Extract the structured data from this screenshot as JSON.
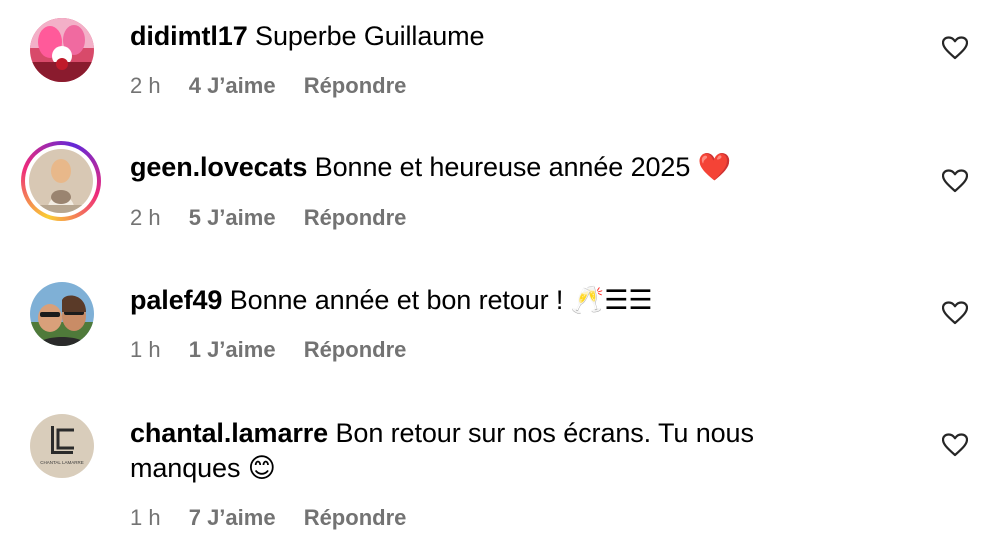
{
  "comments": [
    {
      "username": "didimtl17",
      "text": "Superbe Guillaume",
      "time": "2 h",
      "likes": "4 J’aime",
      "reply": "Répondre",
      "avatar_icon": "avatar-photo-pink"
    },
    {
      "username": "geen.lovecats",
      "text": "Bonne et heureuse année 2025 ",
      "emoji": "❤️",
      "time": "2 h",
      "likes": "5 J’aime",
      "reply": "Répondre",
      "avatar_icon": "avatar-photo-story-ring"
    },
    {
      "username": "palef49",
      "text": "Bonne année et bon retour ! ",
      "emoji": "🥂☰☰",
      "time": "1 h",
      "likes": "1 J’aime",
      "reply": "Répondre",
      "avatar_icon": "avatar-photo-couple"
    },
    {
      "username": "chantal.lamarre",
      "text": "Bon retour sur nos écrans. Tu nous manques ",
      "emoji": "😊",
      "time": "1 h",
      "likes": "7 J’aime",
      "reply": "Répondre",
      "avatar_icon": "avatar-logo-lc",
      "avatar_text": "CHANTAL LAMARRE"
    }
  ],
  "colors": {
    "meta_text": "#737373",
    "story_ring": "#ee2a7b",
    "heart_emoji": "#e0245e"
  }
}
